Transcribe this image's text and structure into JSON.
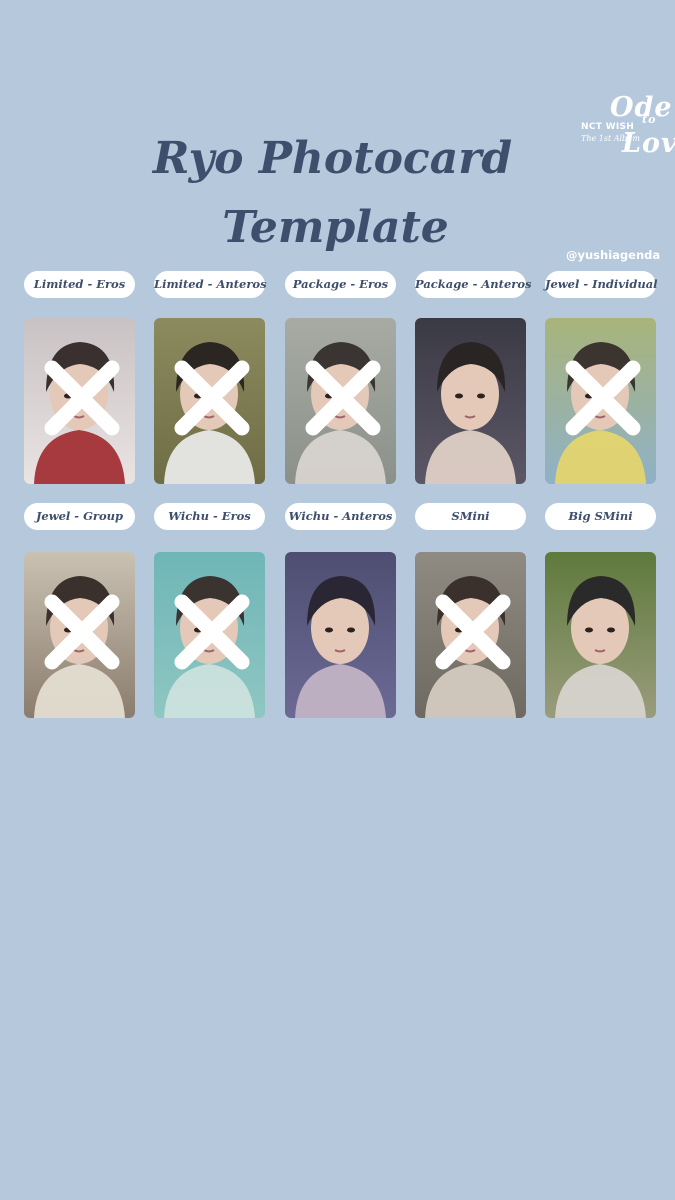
{
  "title": {
    "line1": "Ryo Photocard",
    "line2": "Template"
  },
  "logo": {
    "word_top": "Ode",
    "word_to": "to",
    "word_bottom": "Love",
    "group": "NCT WISH",
    "edition": "The 1st Album"
  },
  "handle": "@yushiagenda",
  "cards": [
    {
      "label": "Limited - Eros",
      "crossed": true,
      "icon": "photo-portrait"
    },
    {
      "label": "Limited - Anteros",
      "crossed": true,
      "icon": "photo-portrait"
    },
    {
      "label": "Package - Eros",
      "crossed": true,
      "icon": "photo-portrait"
    },
    {
      "label": "Package - Anteros",
      "crossed": false,
      "icon": "photo-portrait"
    },
    {
      "label": "Jewel - Individual",
      "crossed": true,
      "icon": "photo-portrait"
    },
    {
      "label": "Jewel - Group",
      "crossed": true,
      "icon": "photo-portrait"
    },
    {
      "label": "Wichu - Eros",
      "crossed": true,
      "icon": "photo-portrait"
    },
    {
      "label": "Wichu - Anteros",
      "crossed": false,
      "icon": "photo-portrait"
    },
    {
      "label": "SMini",
      "crossed": true,
      "icon": "photo-portrait"
    },
    {
      "label": "Big SMini",
      "crossed": false,
      "icon": "photo-portrait"
    }
  ],
  "colors": {
    "background": "#b5c8dc",
    "title": "#3d4f6c",
    "pill": "#ffffff",
    "cross": "#ffffff"
  }
}
